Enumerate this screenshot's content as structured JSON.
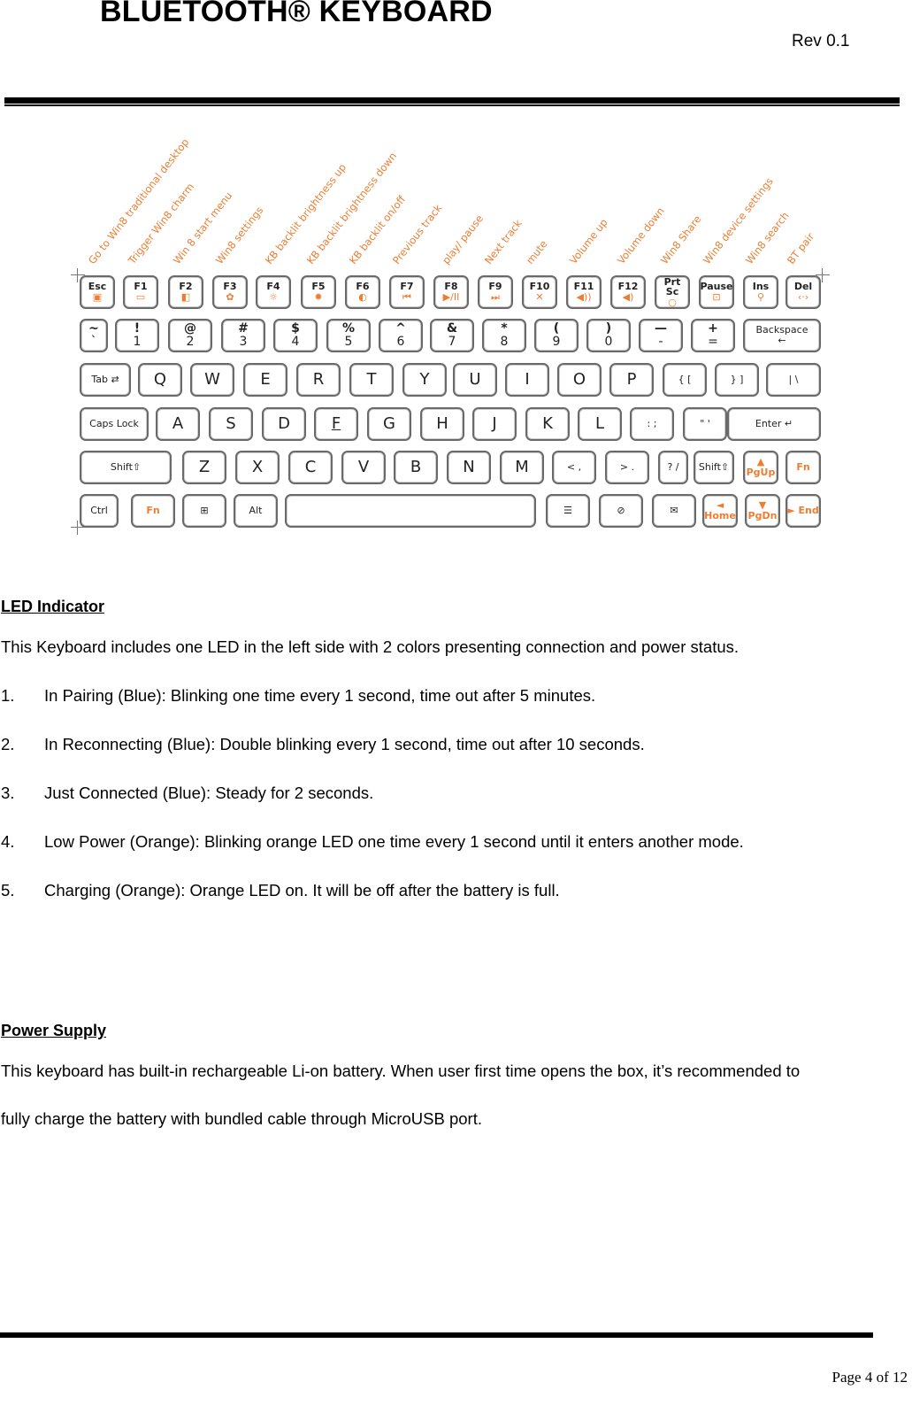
{
  "header": {
    "title": "BLUETOOTH® KEYBOARD",
    "revision": "Rev 0.1"
  },
  "keyboard_figure": {
    "accent_color": "#ee7d31",
    "function_labels": [
      "Go to Win8 traditional desktop",
      "Trigger Win8 charm",
      "Win 8 start menu",
      "Win8 settings",
      "KB backlit brightness up",
      "KB backlit brightness down",
      "KB backlit on/off",
      "Previous track",
      "play/ pause",
      "Next track",
      "mute",
      "Volume up",
      "Volume down",
      "Win8 Share",
      "Win8 device settings",
      "Win8 search",
      "BT pair"
    ],
    "row1": [
      {
        "main": "Esc",
        "sub": "▣"
      },
      {
        "main": "F1",
        "sub": "▭"
      },
      {
        "main": "F2",
        "sub": "◧"
      },
      {
        "main": "F3",
        "sub": "✿"
      },
      {
        "main": "F4",
        "sub": "☼"
      },
      {
        "main": "F5",
        "sub": "✹"
      },
      {
        "main": "F6",
        "sub": "◐"
      },
      {
        "main": "F7",
        "sub": "⏮"
      },
      {
        "main": "F8",
        "sub": "▶/II"
      },
      {
        "main": "F9",
        "sub": "⏭"
      },
      {
        "main": "F10",
        "sub": "✕"
      },
      {
        "main": "F11",
        "sub": "◀))"
      },
      {
        "main": "F12",
        "sub": "◀)"
      },
      {
        "main": "Prt Sc",
        "sub": "○"
      },
      {
        "main": "Pause",
        "sub": "⊡"
      },
      {
        "main": "Ins",
        "sub": "⚲"
      },
      {
        "main": "Del",
        "sub": "‹·›"
      }
    ],
    "row2": [
      {
        "top": "~",
        "bottom": "`"
      },
      {
        "top": "!",
        "bottom": "1"
      },
      {
        "top": "@",
        "bottom": "2"
      },
      {
        "top": "#",
        "bottom": "3"
      },
      {
        "top": "$",
        "bottom": "4"
      },
      {
        "top": "%",
        "bottom": "5"
      },
      {
        "top": "^",
        "bottom": "6"
      },
      {
        "top": "&",
        "bottom": "7"
      },
      {
        "top": "*",
        "bottom": "8"
      },
      {
        "top": "(",
        "bottom": "9"
      },
      {
        "top": ")",
        "bottom": "0"
      },
      {
        "top": "—",
        "bottom": "-"
      },
      {
        "top": "+",
        "bottom": "="
      },
      {
        "top": "Backspace",
        "bottom": "←"
      }
    ],
    "row3": [
      "Tab ⇄",
      "Q",
      "W",
      "E",
      "R",
      "T",
      "Y",
      "U",
      "I",
      "O",
      "P",
      "{ [",
      "} ]",
      "| \\"
    ],
    "row4": [
      "Caps Lock",
      "A",
      "S",
      "D",
      "F",
      "G",
      "H",
      "J",
      "K",
      "L",
      ": ;",
      "\" '",
      "Enter ↵"
    ],
    "row5": [
      "Shift⇧",
      "Z",
      "X",
      "C",
      "V",
      "B",
      "N",
      "M",
      "< ,",
      "> .",
      "? /",
      "Shift⇧",
      "▲ PgUp",
      "Fn"
    ],
    "row6": [
      "Ctrl",
      "Fn",
      "⊞",
      "Alt",
      "",
      "☰",
      "⊘",
      "✉",
      "◄ Home",
      "▼ PgDn",
      "► End"
    ]
  },
  "led_section": {
    "heading": "LED Indicator",
    "intro": "This Keyboard includes one LED in the left side with 2 colors presenting connection and power status.",
    "items": [
      {
        "num": "1.",
        "text": "In Pairing (Blue): Blinking one time every 1 second, time out after 5 minutes."
      },
      {
        "num": "2.",
        "text": "In Reconnecting (Blue): Double blinking every 1 second, time out after 10 seconds."
      },
      {
        "num": "3.",
        "text": "Just Connected (Blue): Steady for 2 seconds."
      },
      {
        "num": "4.",
        "text": "Low Power (Orange): Blinking orange LED one time every 1 second until it enters another mode."
      },
      {
        "num": "5.",
        "text": "Charging (Orange): Orange LED on. It will be off after the battery is full."
      }
    ]
  },
  "power_section": {
    "heading": "Power Supply",
    "line1": "This keyboard has built-in rechargeable Li-on battery. When user first time opens the box, it’s recommended to",
    "line2": "fully charge the battery with bundled cable through MicroUSB port."
  },
  "footer": {
    "page": "Page 4 of 12"
  }
}
